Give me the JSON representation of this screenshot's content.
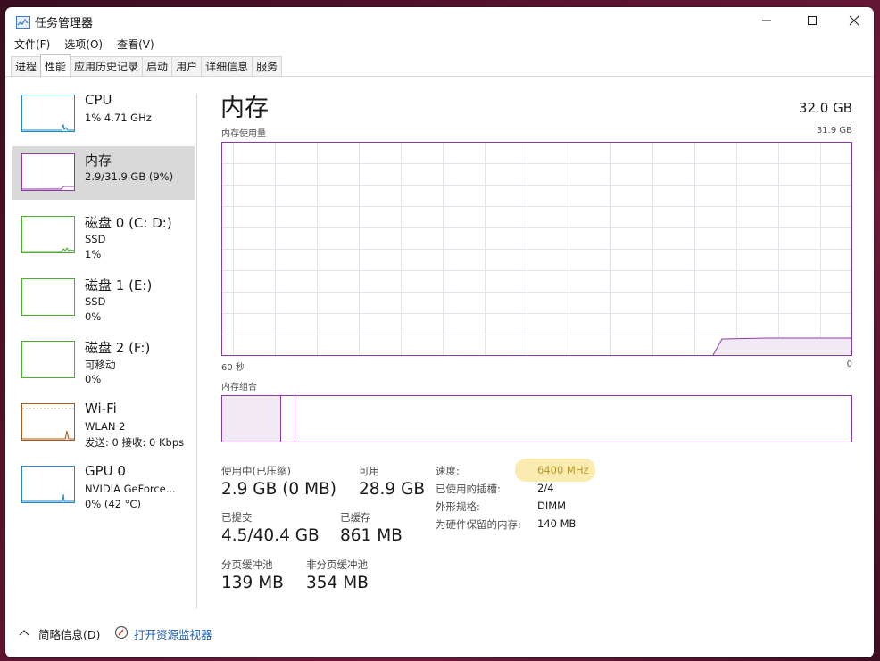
{
  "window": {
    "title": "任务管理器"
  },
  "menu": [
    "文件(F)",
    "选项(O)",
    "查看(V)"
  ],
  "tabs": [
    {
      "label": "进程",
      "active": false
    },
    {
      "label": "性能",
      "active": true
    },
    {
      "label": "应用历史记录",
      "active": false
    },
    {
      "label": "启动",
      "active": false
    },
    {
      "label": "用户",
      "active": false
    },
    {
      "label": "详细信息",
      "active": false
    },
    {
      "label": "服务",
      "active": false
    }
  ],
  "sidebar": {
    "items": [
      {
        "name": "CPU",
        "line1": "1% 4.71 GHz",
        "line2": "",
        "color": "#1f8bc7"
      },
      {
        "name": "内存",
        "line1": "2.9/31.9 GB (9%)",
        "line2": "",
        "color": "#8b3aa6"
      },
      {
        "name": "磁盘 0 (C: D:)",
        "line1": "SSD",
        "line2": "1%",
        "color": "#4caf2f"
      },
      {
        "name": "磁盘 1 (E:)",
        "line1": "SSD",
        "line2": "0%",
        "color": "#4caf2f"
      },
      {
        "name": "磁盘 2 (F:)",
        "line1": "可移动",
        "line2": "0%",
        "color": "#4caf2f"
      },
      {
        "name": "Wi-Fi",
        "line1": "WLAN 2",
        "line2": "发送: 0 接收: 0 Kbps",
        "color": "#a85b1d"
      },
      {
        "name": "GPU 0",
        "line1": "NVIDIA GeForce...",
        "line2": "0% (42 °C)",
        "color": "#1f8bc7"
      }
    ]
  },
  "main": {
    "title": "内存",
    "total": "32.0 GB",
    "usage_label": "内存使用量",
    "usage_max": "31.9 GB",
    "time_left": "60 秒",
    "time_right": "0",
    "composition_label": "内存组合",
    "stats": {
      "in_use_label": "使用中(已压缩)",
      "in_use": "2.9 GB (0 MB)",
      "available_label": "可用",
      "available": "28.9 GB",
      "committed_label": "已提交",
      "committed": "4.5/40.4 GB",
      "cached_label": "已缓存",
      "cached": "861 MB",
      "paged_label": "分页缓冲池",
      "paged": "139 MB",
      "nonpaged_label": "非分页缓冲池",
      "nonpaged": "354 MB"
    },
    "details": [
      {
        "label": "速度:",
        "value": "6400 MHz"
      },
      {
        "label": "已使用的插槽:",
        "value": "2/4"
      },
      {
        "label": "外形规格:",
        "value": "DIMM"
      },
      {
        "label": "为硬件保留的内存:",
        "value": "140 MB"
      }
    ]
  },
  "footer": {
    "summary": "简略信息(D)",
    "monitor": "打开资源监视器"
  },
  "colors": {
    "memory": "#8b3aa6",
    "memory_fill": "#f1e9f4",
    "highlight": "#fbe9a7"
  }
}
